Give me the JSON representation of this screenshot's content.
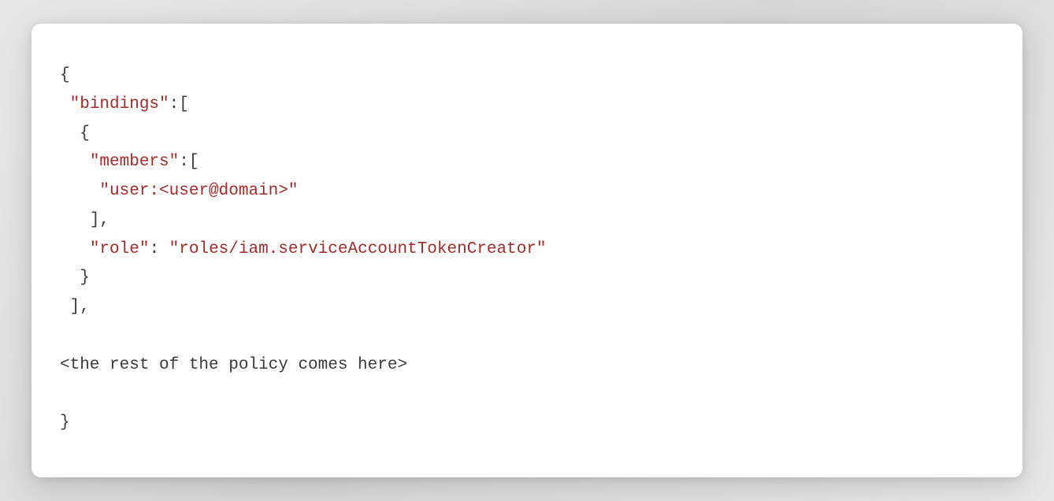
{
  "code": {
    "line1_plain": "{",
    "line2_indent": " ",
    "line2_str": "\"bindings\"",
    "line2_plain": ":[",
    "line3_indent": "  ",
    "line3_plain": "{",
    "line4_indent": "   ",
    "line4_str": "\"members\"",
    "line4_plain": ":[",
    "line5_indent": "    ",
    "line5_str": "\"user:<user@domain>\"",
    "line6_indent": "   ",
    "line6_plain": "],",
    "line7_indent": "   ",
    "line7_str1": "\"role\"",
    "line7_plain_mid": ": ",
    "line7_str2": "\"roles/iam.serviceAccountTokenCreator\"",
    "line8_indent": "  ",
    "line8_plain": "}",
    "line9_indent": " ",
    "line9_plain": "],",
    "line10_blank": "",
    "line11_plain": "<the rest of the policy comes here>",
    "line12_blank": "",
    "line13_plain": "}"
  }
}
